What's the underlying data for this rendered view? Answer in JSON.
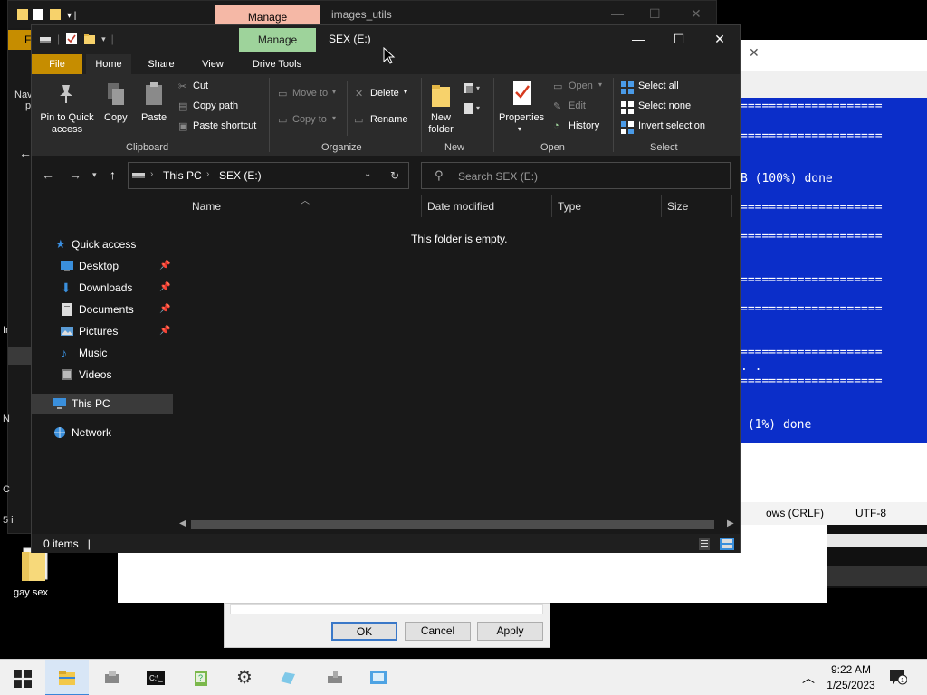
{
  "background": {
    "explorer_manage_tab": "Manage",
    "explorer_title": "images_utils",
    "explorer_file_tab": "F",
    "side_fragments": [
      "Nav",
      "p",
      "Ir",
      "N",
      "5 i",
      "C"
    ],
    "console_lines": [
      "====================",
      "====================",
      "B (100%) done",
      "====================",
      "====================",
      "====================",
      "====================",
      "====================",
      ". .",
      "====================",
      " (1%) done"
    ],
    "notepad_status": {
      "line_endings": "ows (CRLF)",
      "encoding": "UTF-8"
    },
    "dialog_buttons": {
      "ok": "OK",
      "cancel": "Cancel",
      "apply": "Apply"
    },
    "desktop_icon_label": "gay sex"
  },
  "window": {
    "manage_tab": "Manage",
    "title": "SEX (E:)",
    "controls": {
      "minimize": "—",
      "maximize": "☐",
      "close": "✕"
    }
  },
  "ribbon": {
    "tabs": [
      "File",
      "Home",
      "Share",
      "View",
      "Drive Tools"
    ],
    "clipboard": {
      "pin": "Pin to Quick access",
      "pin_line1": "Pin to Quick",
      "pin_line2": "access",
      "copy": "Copy",
      "paste": "Paste",
      "cut": "Cut",
      "copy_path": "Copy path",
      "paste_shortcut": "Paste shortcut",
      "group": "Clipboard"
    },
    "organize": {
      "move_to": "Move to",
      "copy_to": "Copy to",
      "delete": "Delete",
      "rename": "Rename",
      "group": "Organize"
    },
    "new": {
      "new_folder_line1": "New",
      "new_folder_line2": "folder",
      "group": "New"
    },
    "open": {
      "properties": "Properties",
      "open": "Open",
      "edit": "Edit",
      "history": "History",
      "group": "Open"
    },
    "select": {
      "select_all": "Select all",
      "select_none": "Select none",
      "invert": "Invert selection",
      "group": "Select"
    }
  },
  "address": {
    "crumbs": [
      "This PC",
      "SEX (E:)"
    ],
    "search_placeholder": "Search SEX (E:)"
  },
  "nav": {
    "quick_access": "Quick access",
    "items": [
      "Desktop",
      "Downloads",
      "Documents",
      "Pictures",
      "Music",
      "Videos"
    ],
    "this_pc": "This PC",
    "network": "Network"
  },
  "columns": [
    "Name",
    "Date modified",
    "Type",
    "Size"
  ],
  "empty_message": "This folder is empty.",
  "status": {
    "items": "0 items",
    "cursor": "|"
  },
  "taskbar": {
    "time": "9:22 AM",
    "date": "1/25/2023",
    "notification_count": "1",
    "apps": [
      "start-icon",
      "file-explorer-icon",
      "server-manager-icon",
      "cmd-icon",
      "notepad-icon",
      "settings-icon",
      "gems-icon",
      "tools-icon",
      "control-panel-icon"
    ]
  },
  "colors": {
    "accent": "#c68d00",
    "manage_green": "#9ed39b",
    "console_blue": "#0b2ec9",
    "help_blue": "#1a73d6"
  }
}
